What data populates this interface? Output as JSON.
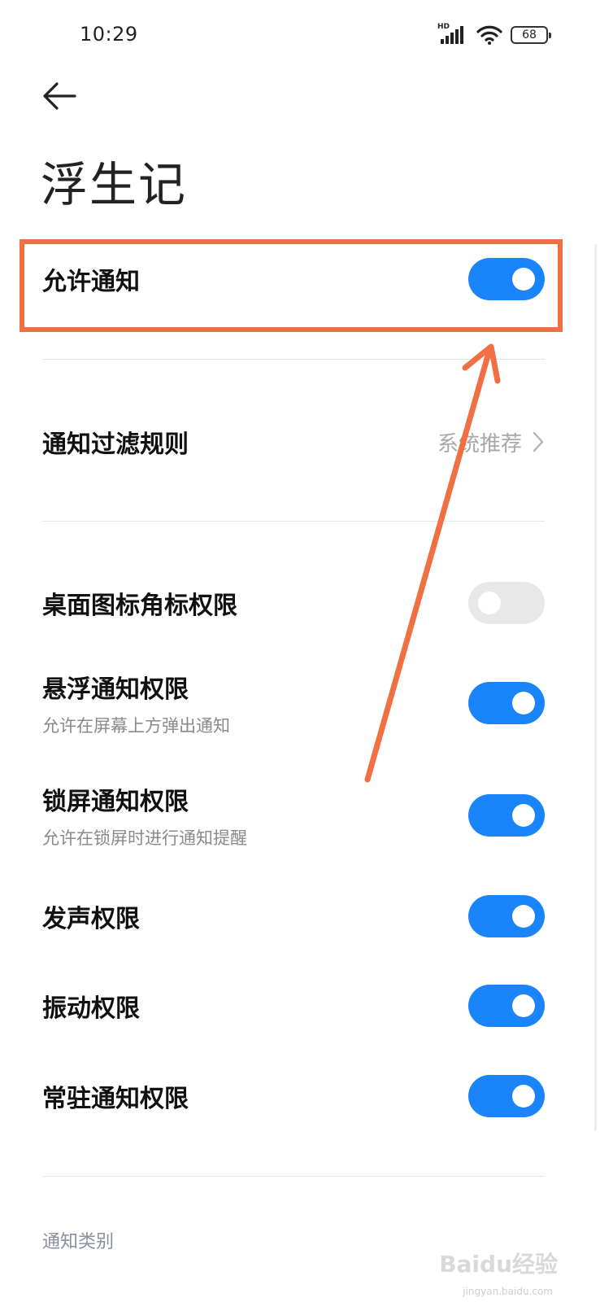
{
  "status_bar": {
    "time": "10:29",
    "network_label": "HD",
    "battery": "68"
  },
  "header": {
    "title": "浮生记"
  },
  "settings": {
    "allow_notifications": {
      "label": "允许通知",
      "enabled": true
    },
    "filter_rules": {
      "label": "通知过滤规则",
      "value": "系统推荐"
    },
    "badge_permission": {
      "label": "桌面图标角标权限",
      "enabled": false
    },
    "floating_permission": {
      "label": "悬浮通知权限",
      "sub": "允许在屏幕上方弹出通知",
      "enabled": true
    },
    "lockscreen_permission": {
      "label": "锁屏通知权限",
      "sub": "允许在锁屏时进行通知提醒",
      "enabled": true
    },
    "sound_permission": {
      "label": "发声权限",
      "enabled": true
    },
    "vibration_permission": {
      "label": "振动权限",
      "enabled": true
    },
    "persistent_permission": {
      "label": "常驻通知权限",
      "enabled": true
    }
  },
  "section": {
    "categories_label": "通知类别"
  },
  "watermark": {
    "text": "Baidu经验",
    "sub": "jingyan.baidu.com"
  },
  "colors": {
    "accent": "#1a84fb",
    "toggle_off": "#e8e8e8",
    "annotation": "#f07044"
  },
  "icons": {
    "back": "arrow-left-icon",
    "chevron": "chevron-right-icon",
    "signal": "signal-icon",
    "wifi": "wifi-icon",
    "battery": "battery-icon"
  }
}
